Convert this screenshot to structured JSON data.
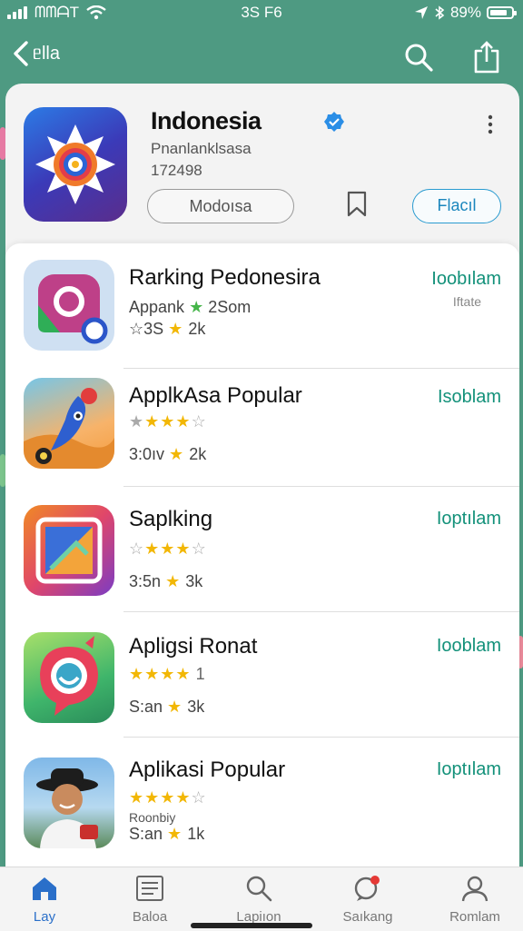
{
  "status_bar": {
    "carrier": "ᗰᗰᗩT",
    "center": "3S F6",
    "battery": "89%",
    "colors": {
      "text": "#ffffff",
      "background": "#4e9a82"
    }
  },
  "nav": {
    "back_label": "ᥱlla",
    "icons": [
      "chevron-left-icon",
      "search-icon",
      "share-icon"
    ]
  },
  "app_header": {
    "title": "Indonesia",
    "subtitle": "Pnanlanklsasa",
    "meta": "172498",
    "secondary_button": "Modoısa",
    "primary_button": "Flacıl",
    "icons": [
      "verified-badge-icon",
      "more-icon",
      "bookmark-icon"
    ]
  },
  "apps": [
    {
      "name": "Rarking Pedonesira",
      "line2": "Appank",
      "line2_tail": "2Som",
      "line3_prefix": "☆3S",
      "line3_tail": "2k",
      "action": "Ioobılam",
      "action_sub": "Iftate"
    },
    {
      "name": "ApplkAsa Popular",
      "rating": 4,
      "line3_prefix": "3:0ıv",
      "line3_tail": "2k",
      "action": "Isoblam"
    },
    {
      "name": "Saplking",
      "rating": 4,
      "line3_prefix": "3:5n",
      "line3_tail": "3k",
      "action": "Ioptılam"
    },
    {
      "name": "Apligsi Ronat",
      "rating": 4,
      "rating_text": "1",
      "line3_prefix": "S:an",
      "line3_tail": "3k",
      "action": "Iooblam"
    },
    {
      "name": "Aplikasi Popular",
      "rating": 4,
      "sub_note": "Roonbiy",
      "line3_prefix": "S:an",
      "line3_tail": "1k",
      "action": "Ioptılam"
    }
  ],
  "tab_bar": {
    "tabs": [
      {
        "label": "Lay",
        "icon": "home-icon"
      },
      {
        "label": "Baloa",
        "icon": "list-icon"
      },
      {
        "label": "Lapiıon",
        "icon": "search-icon"
      },
      {
        "label": "Saıkang",
        "icon": "chat-icon"
      },
      {
        "label": "Romlam",
        "icon": "profile-icon"
      }
    ],
    "active_tab": "Lay"
  },
  "colors": {
    "accent": "#13917a",
    "brand_blue": "#2a6fc9",
    "star": "#f2b705"
  }
}
